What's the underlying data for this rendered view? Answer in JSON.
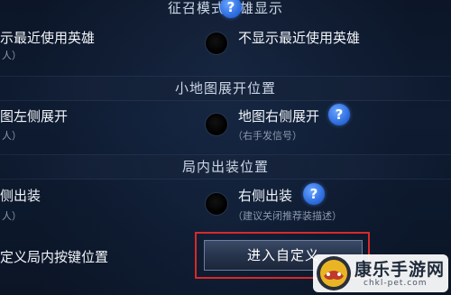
{
  "sections": {
    "hero_display": {
      "title": "征召模式英雄显示",
      "left_label": "示最近使用英雄",
      "left_sub": "人）",
      "right_label": "不显示最近使用英雄"
    },
    "minimap": {
      "title": "小地图展开位置",
      "left_label": "图左侧展开",
      "left_sub": "人）",
      "right_label": "地图右侧展开",
      "right_sub": "（右手发信号）"
    },
    "shop": {
      "title": "局内出装位置",
      "left_label": "侧出装",
      "left_sub": "人）",
      "right_label": "右侧出装",
      "right_sub": "（建议关闭推荐装描述）"
    },
    "custom_keys": {
      "left_label": "定义局内按键位置",
      "button_label": "进入自定义"
    }
  },
  "help_glyph": "?",
  "watermark": {
    "name": "康乐手游网",
    "url": "chkl-pet.com",
    "logo_icon": "game-controller-logo"
  },
  "colors": {
    "highlight_frame": "#d62a2a",
    "help_icon": "#2f6fe0",
    "background": "#0e1b31"
  }
}
